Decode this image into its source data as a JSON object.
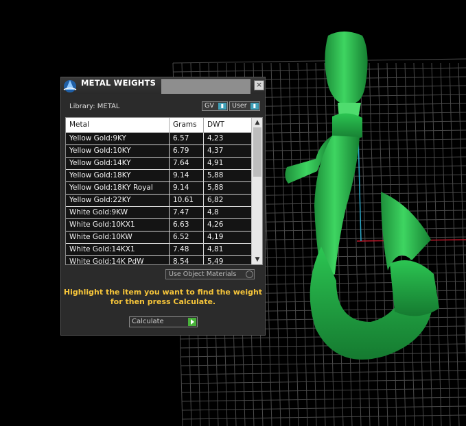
{
  "window": {
    "title": "METAL WEIGHTS",
    "close_symbol": "×"
  },
  "library": {
    "label": "Library: METAL",
    "gv_label": "GV",
    "user_label": "User",
    "toggle_glyph": "▮"
  },
  "table": {
    "headers": [
      "Metal",
      "Grams",
      "DWT"
    ],
    "rows": [
      [
        "Yellow Gold:9KY",
        "6.57",
        "4,23"
      ],
      [
        "Yellow Gold:10KY",
        "6.79",
        "4,37"
      ],
      [
        "Yellow Gold:14KY",
        "7.64",
        "4,91"
      ],
      [
        "Yellow Gold:18KY",
        "9.14",
        "5,88"
      ],
      [
        "Yellow Gold:18KY Royal",
        "9.14",
        "5,88"
      ],
      [
        "Yellow Gold:22KY",
        "10.61",
        "6,82"
      ],
      [
        "White Gold:9KW",
        "7.47",
        "4,8"
      ],
      [
        "White Gold:10KX1",
        "6.63",
        "4,26"
      ],
      [
        "White Gold:10KW",
        "6.52",
        "4,19"
      ],
      [
        "White Gold:14KX1",
        "7.48",
        "4,81"
      ],
      [
        "White Gold:14K PdW",
        "8.54",
        "5,49"
      ]
    ],
    "scroll_up": "▲",
    "scroll_down": "▼"
  },
  "options": {
    "use_object_materials": "Use Object Materials"
  },
  "instruction": {
    "line1": "Highlight the item you want to find the weight",
    "line2": "for then press Calculate."
  },
  "calculate": {
    "label": "Calculate"
  },
  "colors": {
    "model_green": "#2fb84f",
    "accent_yellow": "#f6c53a",
    "grid": "#4a4a4a",
    "axis_red": "#c0182a",
    "axis_cyan": "#2ca8c8"
  },
  "icons": [
    "app-logo-icon",
    "close-icon",
    "scroll-up-icon",
    "scroll-down-icon",
    "play-arrow-icon"
  ]
}
